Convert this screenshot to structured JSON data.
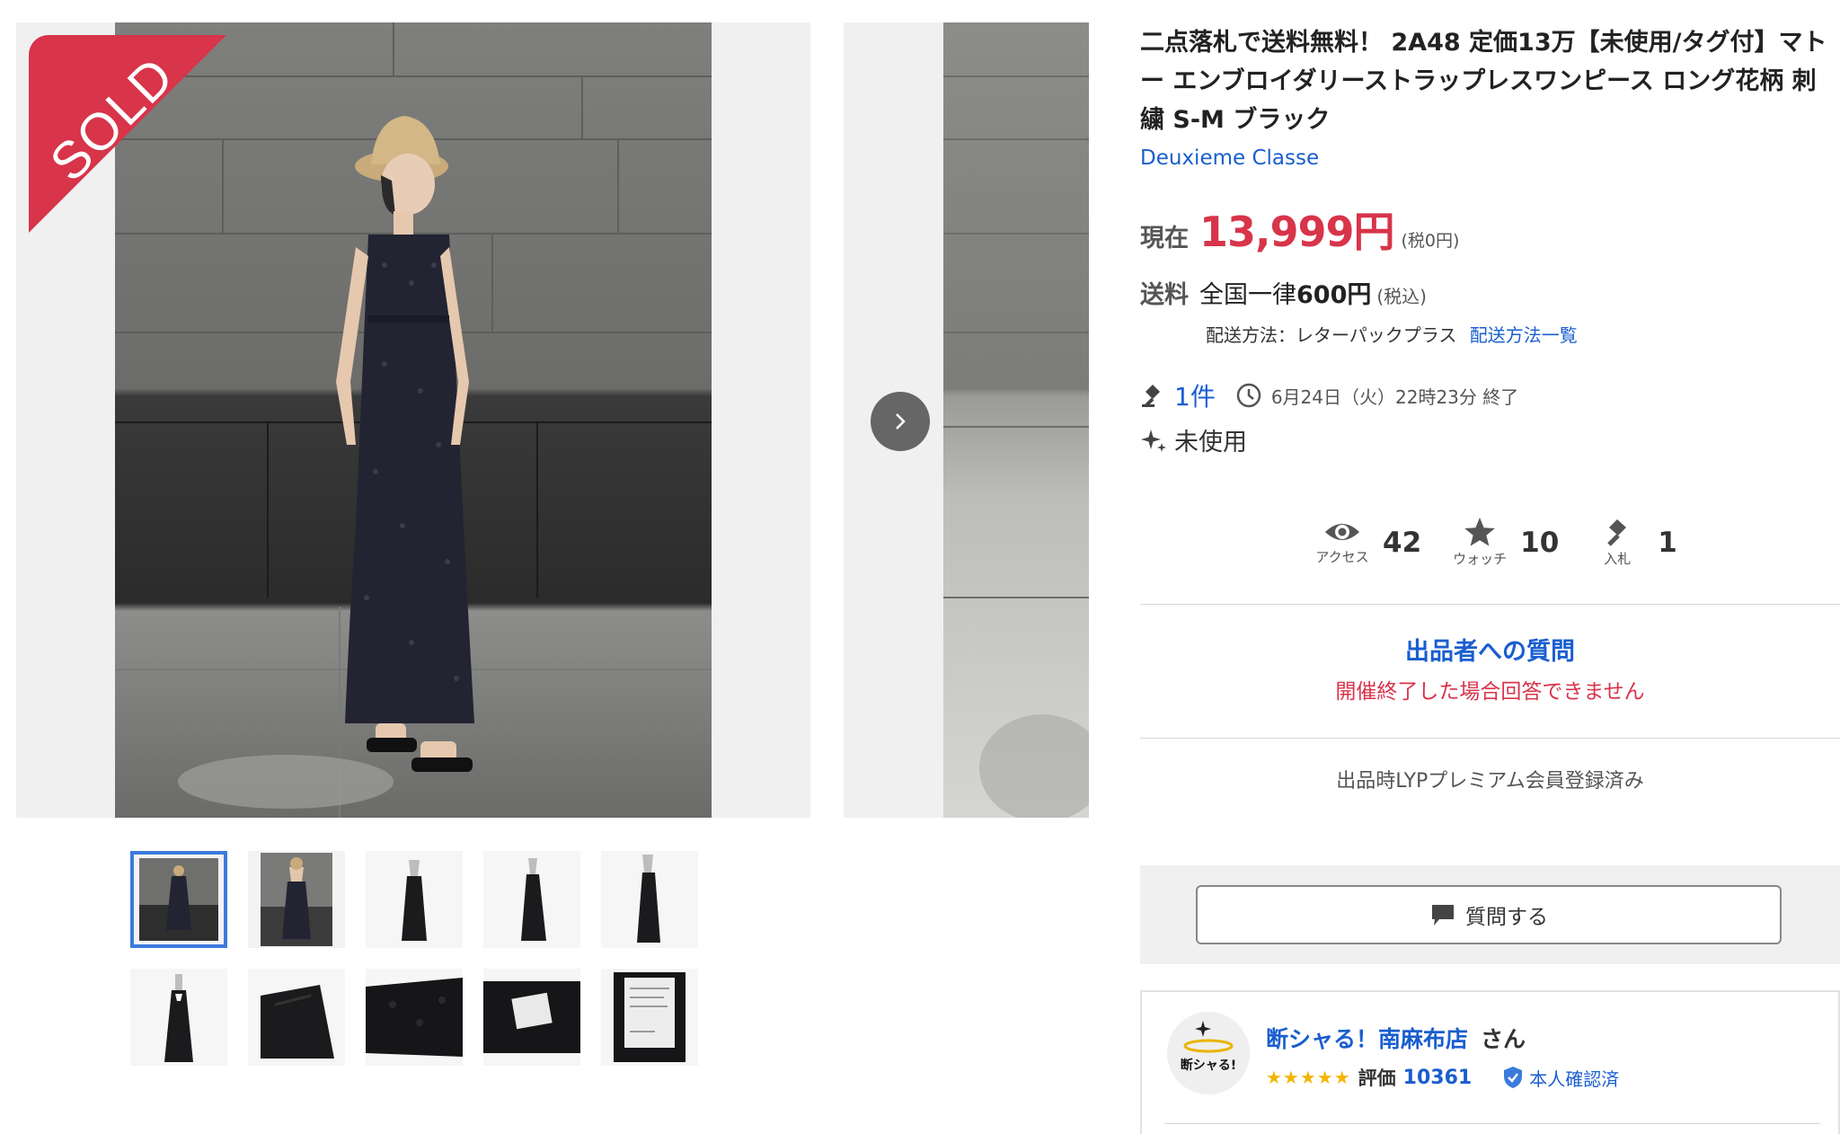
{
  "gallery": {
    "sold_badge": "SOLD",
    "thumbnail_names": [
      "thumb-1",
      "thumb-2",
      "thumb-3",
      "thumb-4",
      "thumb-5",
      "thumb-6",
      "thumb-7",
      "thumb-8",
      "thumb-9",
      "thumb-10"
    ],
    "active_thumbnail": 1
  },
  "item": {
    "title": "二点落札で送料無料！ 2A48 定価13万【未使用/タグ付】マトー エンブロイダリーストラップレスワンピース ロング花柄 刺繍 S-M ブラック",
    "brand": "Deuxieme Classe"
  },
  "price": {
    "label": "現在",
    "amount": "13,999円",
    "tax_note": "(税0円)"
  },
  "shipping": {
    "label": "送料",
    "area": "全国一律",
    "amount": "600円",
    "tax_note": "(税込)",
    "method": "配送方法：レターパックプラス",
    "list_link": "配送方法一覧"
  },
  "auction": {
    "bid_count": "1件",
    "end_time": "6月24日（火）22時23分 終了",
    "condition": "未使用"
  },
  "stats": {
    "access_label": "アクセス",
    "access_value": "42",
    "watch_label": "ウォッチ",
    "watch_value": "10",
    "bid_label": "入札",
    "bid_value": "1"
  },
  "qa": {
    "title": "出品者への質問",
    "note": "開催終了した場合回答できません"
  },
  "premium_note": "出品時LYPプレミアム会員登録済み",
  "ask_button": "質問する",
  "seller": {
    "name": "断シャる！南麻布店",
    "suffix": "さん",
    "avatar_text": "断シャる!",
    "stars": "★★★★★",
    "rating_label": "評価",
    "rating_value": "10361",
    "verified": "本人確認済"
  },
  "colors": {
    "accent_red": "#d8344a",
    "link_blue": "#1a5ecf",
    "star_gold": "#f5b400"
  }
}
